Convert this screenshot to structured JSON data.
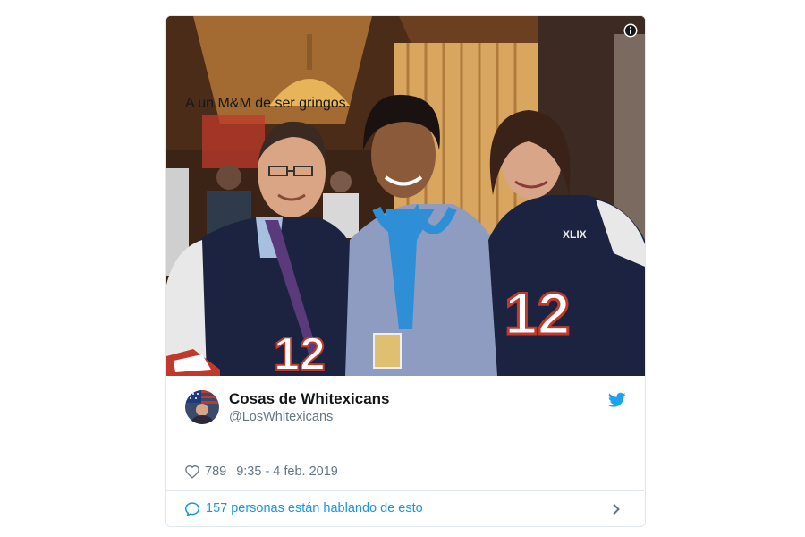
{
  "tweet": {
    "display_name": "Cosas de Whitexicans",
    "handle": "@LosWhitexicans",
    "text": "A un M&M de ser gringos.",
    "like_count": "789",
    "timestamp": "9:35 - 4 feb. 2019",
    "conversation_text": "157 personas están hablando de esto",
    "photo_jersey_number": "12",
    "photo_patch_text": "XLIX"
  },
  "icons": {
    "info": "info-icon",
    "twitter": "twitter-bird-icon",
    "like": "heart-icon",
    "conversation": "speech-bubble-icon",
    "chevron": "chevron-right-icon"
  },
  "colors": {
    "twitter_blue": "#1b95e0",
    "secondary_text": "#657786",
    "primary_text": "#14171a",
    "border": "#e1e8ed"
  }
}
